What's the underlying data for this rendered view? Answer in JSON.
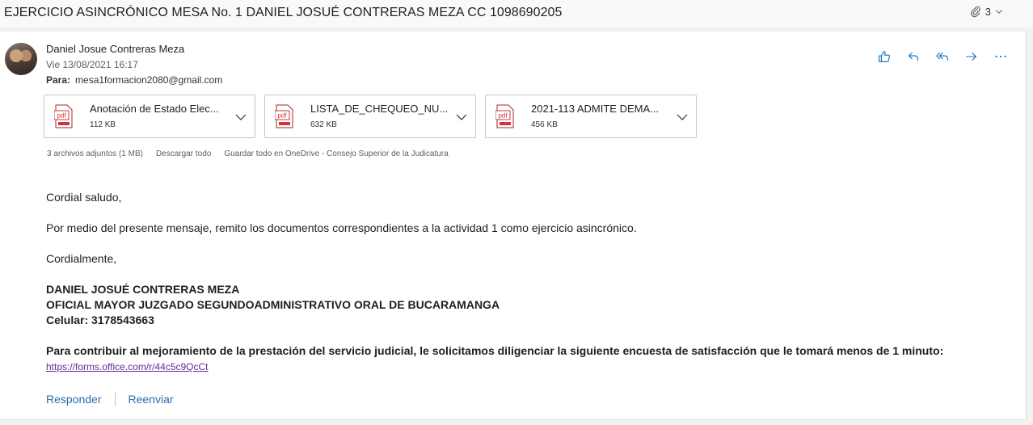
{
  "email": {
    "subject": "EJERCICIO ASINCRÓNICO MESA No. 1 DANIEL JOSUÉ CONTRERAS MEZA CC 1098690205",
    "attachment_count": "3",
    "sender_name": "Daniel Josue Contreras Meza",
    "sent_date": "Vie 13/08/2021 16:17",
    "to_label": "Para:",
    "to_address": "mesa1formacion2080@gmail.com"
  },
  "attachments": [
    {
      "name": "Anotación de Estado Elec...",
      "size": "112 KB",
      "icon": "pdf-icon",
      "icon_label": "pdf"
    },
    {
      "name": "LISTA_DE_CHEQUEO_NU...",
      "size": "632 KB",
      "icon": "pdf-icon",
      "icon_label": "pdf"
    },
    {
      "name": "2021-113 ADMITE DEMA...",
      "size": "456 KB",
      "icon": "pdf-icon",
      "icon_label": "pdf"
    }
  ],
  "attachment_meta": {
    "summary": "3 archivos adjuntos (1 MB)",
    "download_all": "Descargar todo",
    "save_onedrive": "Guardar todo en OneDrive - Consejo Superior de la Judicatura"
  },
  "body": {
    "greeting": "Cordial saludo,",
    "main": "Por medio del presente mensaje, remito los documentos correspondientes a la actividad 1 como ejercicio asincrónico.",
    "closing": "Cordialmente,",
    "signature_name": "DANIEL JOSUÉ CONTRERAS MEZA",
    "signature_title": "OFICIAL MAYOR JUZGADO SEGUNDOADMINISTRATIVO ORAL DE BUCARAMANGA",
    "signature_phone": "Celular: 3178543663",
    "survey_text": "Para contribuir al mejoramiento de la prestación del servicio judicial, le solicitamos diligenciar la siguiente encuesta de satisfacción que le tomará menos de 1 minuto: ",
    "survey_link": "https://forms.office.com/r/44c5c9QcCt"
  },
  "footer": {
    "reply": "Responder",
    "forward": "Reenviar"
  },
  "toolbar_icons": [
    "like-icon",
    "reply-icon",
    "reply-all-icon",
    "forward-icon",
    "more-icon"
  ],
  "colors": {
    "accent": "#0f6cbd",
    "pdf_red": "#d13438",
    "link": "#5c2d91"
  }
}
